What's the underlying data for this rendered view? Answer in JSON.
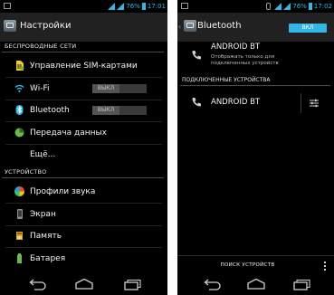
{
  "status": {
    "battery": "76%",
    "time_left": "17:01",
    "time_right": "17:02"
  },
  "settings": {
    "title": "Настройки",
    "section_wireless": "БЕСПРОВОДНЫЕ СЕТИ",
    "section_device": "УСТРОЙСТВО",
    "items": {
      "sim": "Управление SIM-картами",
      "wifi": "Wi-Fi",
      "bluetooth": "Bluetooth",
      "data": "Передача данных",
      "more": "Ещё...",
      "sound": "Профили звука",
      "display": "Экран",
      "storage": "Память",
      "battery": "Батарея"
    },
    "wifi_switch": "ВЫКЛ",
    "bluetooth_switch": "ВЫКЛ"
  },
  "bluetooth": {
    "title": "Bluetooth",
    "toggle": "ВКЛ",
    "device_name": "ANDROID BT",
    "visibility": "Отображать только для подключенных устройств",
    "paired_header": "ПОДКЛЮЧЕННЫЕ УСТРОЙСТВА",
    "paired_device": "ANDROID BT",
    "search_button": "ПОИСК УСТРОЙСТВ"
  },
  "colors": {
    "accent": "#33b5e5",
    "background": "#000000",
    "actionbar": "#212121"
  }
}
